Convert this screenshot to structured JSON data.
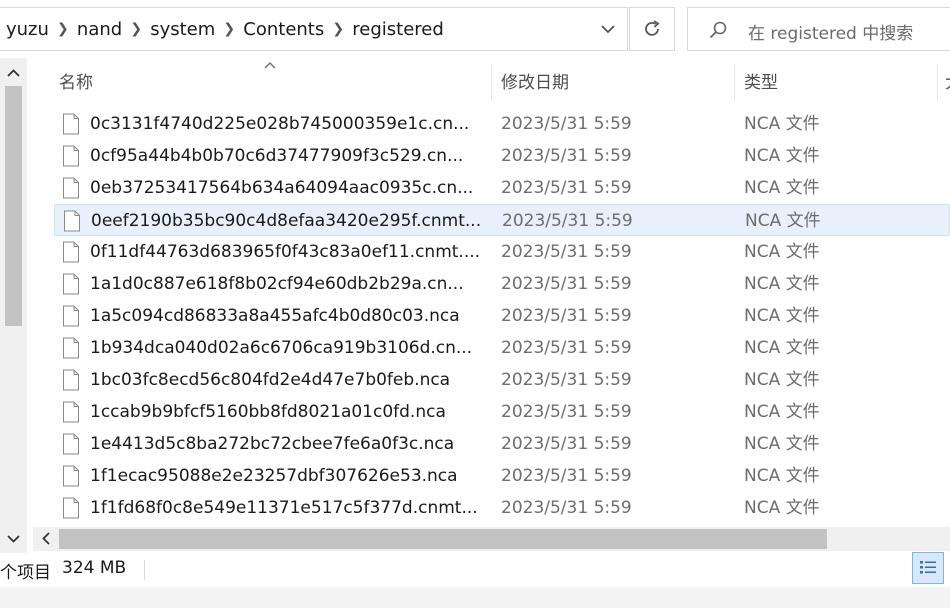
{
  "breadcrumb": [
    "yuzu",
    "nand",
    "system",
    "Contents",
    "registered"
  ],
  "search": {
    "placeholder": "在 registered 中搜索"
  },
  "columns": {
    "name": "名称",
    "modified": "修改日期",
    "type": "类型",
    "size_partial": "大"
  },
  "files": [
    {
      "name": "0c3131f4740d225e028b745000359e1c.cn...",
      "modified": "2023/5/31 5:59",
      "type": "NCA 文件"
    },
    {
      "name": "0cf95a44b4b0b70c6d37477909f3c529.cn...",
      "modified": "2023/5/31 5:59",
      "type": "NCA 文件"
    },
    {
      "name": "0eb37253417564b634a64094aac0935c.cn...",
      "modified": "2023/5/31 5:59",
      "type": "NCA 文件"
    },
    {
      "name": "0eef2190b35bc90c4d8efaa3420e295f.cnmt...",
      "modified": "2023/5/31 5:59",
      "type": "NCA 文件",
      "selected": true
    },
    {
      "name": "0f11df44763d683965f0f43c83a0ef11.cnmt....",
      "modified": "2023/5/31 5:59",
      "type": "NCA 文件"
    },
    {
      "name": "1a1d0c887e618f8b02cf94e60db2b29a.cn...",
      "modified": "2023/5/31 5:59",
      "type": "NCA 文件"
    },
    {
      "name": "1a5c094cd86833a8a455afc4b0d80c03.nca",
      "modified": "2023/5/31 5:59",
      "type": "NCA 文件"
    },
    {
      "name": "1b934dca040d02a6c6706ca919b3106d.cn...",
      "modified": "2023/5/31 5:59",
      "type": "NCA 文件"
    },
    {
      "name": "1bc03fc8ecd56c804fd2e4d47e7b0feb.nca",
      "modified": "2023/5/31 5:59",
      "type": "NCA 文件"
    },
    {
      "name": "1ccab9b9bfcf5160bb8fd8021a01c0fd.nca",
      "modified": "2023/5/31 5:59",
      "type": "NCA 文件"
    },
    {
      "name": "1e4413d5c8ba272bc72cbee7fe6a0f3c.nca",
      "modified": "2023/5/31 5:59",
      "type": "NCA 文件"
    },
    {
      "name": "1f1ecac95088e2e23257dbf307626e53.nca",
      "modified": "2023/5/31 5:59",
      "type": "NCA 文件"
    },
    {
      "name": "1f1fd68f0c8e549e11371e517c5f377d.cnmt...",
      "modified": "2023/5/31 5:59",
      "type": "NCA 文件"
    }
  ],
  "status": {
    "item_count": "个项目",
    "selection_size": "324 MB"
  },
  "icons": {
    "address_dropdown": "chevron-down-icon",
    "refresh": "refresh-icon",
    "search": "search-icon",
    "sort": "sort-ascending-icon",
    "file": "file-icon",
    "details_view": "details-view-icon"
  },
  "colors": {
    "selection_bg": "#e8f1fb",
    "selection_border": "#cde3f7",
    "view_active": "#d8e8f8"
  }
}
